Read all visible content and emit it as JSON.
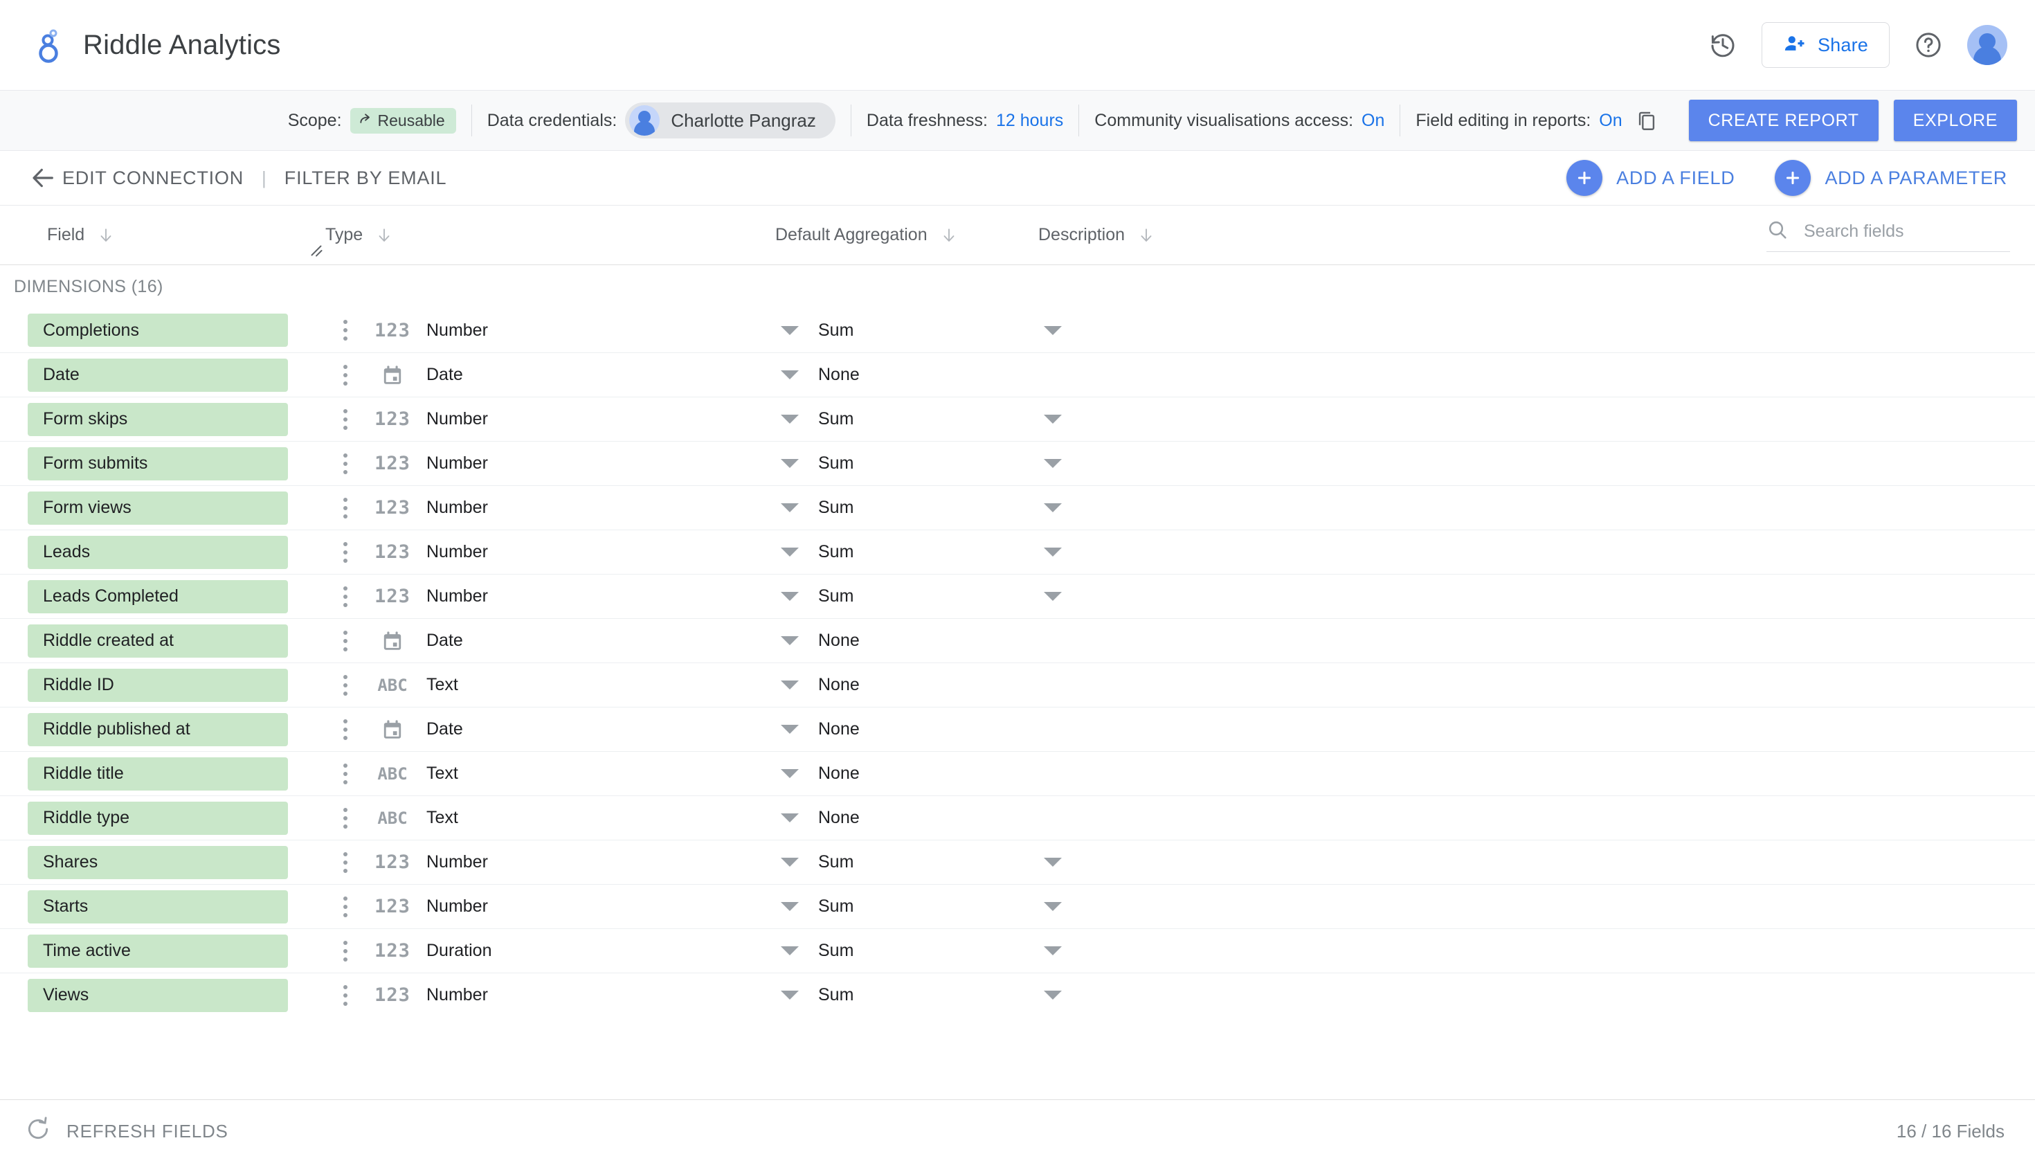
{
  "header": {
    "app_title": "Riddle Analytics",
    "logo_icon": "data-studio-logo-icon",
    "history_icon": "history-icon",
    "share_label": "Share",
    "share_icon": "person-add-icon",
    "help_icon": "help-circle-icon",
    "avatar_icon": "user-avatar-icon"
  },
  "toolbar": {
    "scope_label": "Scope:",
    "scope_value": "Reusable",
    "scope_icon": "share-arrow-icon",
    "credentials_label": "Data credentials:",
    "credentials_value": "Charlotte Pangraz",
    "freshness_label": "Data freshness:",
    "freshness_value": "12 hours",
    "community_label": "Community visualisations access:",
    "community_value": "On",
    "field_editing_label": "Field editing in reports:",
    "field_editing_value": "On",
    "copy_icon": "copy-icon",
    "create_report_label": "CREATE REPORT",
    "explore_label": "EXPLORE",
    "accent_blue": "#5b85ec",
    "link_blue": "#1a73e8",
    "chip_green": "#ceead6"
  },
  "nav": {
    "back_icon": "arrow-left-icon",
    "edit_connection_label": "EDIT CONNECTION",
    "separator": "|",
    "filter_by_email_label": "FILTER BY EMAIL",
    "add_field_label": "ADD A FIELD",
    "add_parameter_label": "ADD A PARAMETER",
    "plus_icon": "plus-icon"
  },
  "table": {
    "columns": [
      {
        "label": "Field",
        "sort_icon": "sort-down-arrow-icon"
      },
      {
        "label": "Type",
        "sort_icon": "sort-down-arrow-icon"
      },
      {
        "label": "Default Aggregation",
        "sort_icon": "sort-down-arrow-icon"
      },
      {
        "label": "Description",
        "sort_icon": "sort-down-arrow-icon"
      }
    ],
    "search_placeholder": "Search fields",
    "search_value": "",
    "search_icon": "search-icon",
    "resize_handle_icon": "column-resize-handle-icon",
    "section_label": "DIMENSIONS (16)",
    "chip_color": "#c9e7c9",
    "rows": [
      {
        "name": "Completions",
        "type_icon": "123",
        "type": "Number",
        "aggregation": "Sum",
        "agg_caret": true,
        "description": ""
      },
      {
        "name": "Date",
        "type_icon": "calendar",
        "type": "Date",
        "aggregation": "None",
        "agg_caret": false,
        "description": ""
      },
      {
        "name": "Form skips",
        "type_icon": "123",
        "type": "Number",
        "aggregation": "Sum",
        "agg_caret": true,
        "description": ""
      },
      {
        "name": "Form submits",
        "type_icon": "123",
        "type": "Number",
        "aggregation": "Sum",
        "agg_caret": true,
        "description": ""
      },
      {
        "name": "Form views",
        "type_icon": "123",
        "type": "Number",
        "aggregation": "Sum",
        "agg_caret": true,
        "description": ""
      },
      {
        "name": "Leads",
        "type_icon": "123",
        "type": "Number",
        "aggregation": "Sum",
        "agg_caret": true,
        "description": ""
      },
      {
        "name": "Leads Completed",
        "type_icon": "123",
        "type": "Number",
        "aggregation": "Sum",
        "agg_caret": true,
        "description": ""
      },
      {
        "name": "Riddle created at",
        "type_icon": "calendar",
        "type": "Date",
        "aggregation": "None",
        "agg_caret": false,
        "description": ""
      },
      {
        "name": "Riddle ID",
        "type_icon": "ABC",
        "type": "Text",
        "aggregation": "None",
        "agg_caret": false,
        "description": ""
      },
      {
        "name": "Riddle published at",
        "type_icon": "calendar",
        "type": "Date",
        "aggregation": "None",
        "agg_caret": false,
        "description": ""
      },
      {
        "name": "Riddle title",
        "type_icon": "ABC",
        "type": "Text",
        "aggregation": "None",
        "agg_caret": false,
        "description": ""
      },
      {
        "name": "Riddle type",
        "type_icon": "ABC",
        "type": "Text",
        "aggregation": "None",
        "agg_caret": false,
        "description": ""
      },
      {
        "name": "Shares",
        "type_icon": "123",
        "type": "Number",
        "aggregation": "Sum",
        "agg_caret": true,
        "description": ""
      },
      {
        "name": "Starts",
        "type_icon": "123",
        "type": "Number",
        "aggregation": "Sum",
        "agg_caret": true,
        "description": ""
      },
      {
        "name": "Time active",
        "type_icon": "123",
        "type": "Duration",
        "aggregation": "Sum",
        "agg_caret": true,
        "description": ""
      },
      {
        "name": "Views",
        "type_icon": "123",
        "type": "Number",
        "aggregation": "Sum",
        "agg_caret": true,
        "description": ""
      }
    ]
  },
  "footer": {
    "refresh_label": "REFRESH FIELDS",
    "refresh_icon": "refresh-icon",
    "field_count": "16 / 16 Fields"
  }
}
